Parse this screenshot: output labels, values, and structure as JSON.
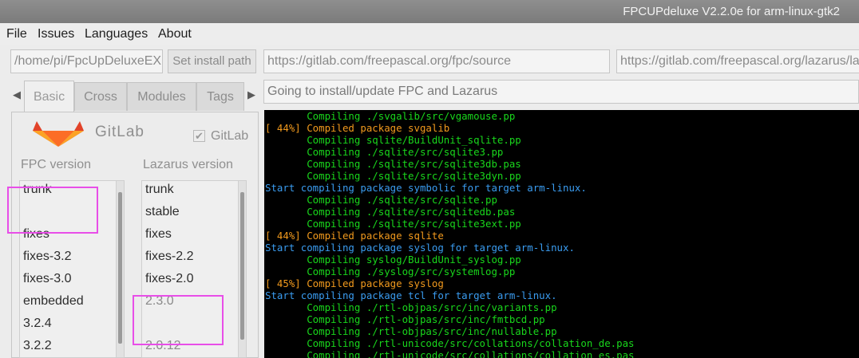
{
  "window": {
    "title": "FPCUPdeluxe V2.2.0e for arm-linux-gtk2"
  },
  "menu": {
    "items": [
      "File",
      "Issues",
      "Languages",
      "About"
    ]
  },
  "install_path": {
    "value": "/home/pi/FpcUpDeluxeEX",
    "button_label": "Set install path"
  },
  "urls": {
    "fpc_source": "https://gitlab.com/freepascal.org/fpc/source",
    "lazarus_source": "https://gitlab.com/freepascal.org/lazarus/la"
  },
  "status": {
    "text": "Going to install/update FPC and Lazarus"
  },
  "tabs": [
    "Basic",
    "Cross",
    "Modules",
    "Tags"
  ],
  "gitlab": {
    "logo_text": "GitLab",
    "checkbox_label": "GitLab",
    "checked": true
  },
  "fpc": {
    "label": "FPC version",
    "items": [
      "trunk",
      "",
      "fixes",
      "fixes-3.2",
      "fixes-3.0",
      "embedded",
      "3.2.4",
      "3.2.2"
    ]
  },
  "lazarus": {
    "label": "Lazarus version",
    "items": [
      "trunk",
      "stable",
      "fixes",
      "fixes-2.2",
      "fixes-2.0",
      "2.3.0",
      "",
      "2.0.12"
    ]
  },
  "colors": {
    "green": "#19d71c",
    "orange": "#f29a1d",
    "blue": "#3a9cf0",
    "highlight": "#e84ee8"
  },
  "console": {
    "lines": [
      {
        "text": "       Compiling ./svgalib/src/vgamouse.pp",
        "color": "green"
      },
      {
        "text": "[ 44%] Compiled package svgalib",
        "color": "orange"
      },
      {
        "text": "       Compiling sqlite/BuildUnit_sqlite.pp",
        "color": "green"
      },
      {
        "text": "       Compiling ./sqlite/src/sqlite3.pp",
        "color": "green"
      },
      {
        "text": "       Compiling ./sqlite/src/sqlite3db.pas",
        "color": "green"
      },
      {
        "text": "       Compiling ./sqlite/src/sqlite3dyn.pp",
        "color": "green"
      },
      {
        "text": "Start compiling package symbolic for target arm-linux.",
        "color": "blue"
      },
      {
        "text": "       Compiling ./sqlite/src/sqlite.pp",
        "color": "green"
      },
      {
        "text": "       Compiling ./sqlite/src/sqlitedb.pas",
        "color": "green"
      },
      {
        "text": "       Compiling ./sqlite/src/sqlite3ext.pp",
        "color": "green"
      },
      {
        "text": "[ 44%] Compiled package sqlite",
        "color": "orange"
      },
      {
        "text": "Start compiling package syslog for target arm-linux.",
        "color": "blue"
      },
      {
        "text": "       Compiling syslog/BuildUnit_syslog.pp",
        "color": "green"
      },
      {
        "text": "       Compiling ./syslog/src/systemlog.pp",
        "color": "green"
      },
      {
        "text": "[ 45%] Compiled package syslog",
        "color": "orange"
      },
      {
        "text": "Start compiling package tcl for target arm-linux.",
        "color": "blue"
      },
      {
        "text": "       Compiling ./rtl-objpas/src/inc/variants.pp",
        "color": "green"
      },
      {
        "text": "       Compiling ./rtl-objpas/src/inc/fmtbcd.pp",
        "color": "green"
      },
      {
        "text": "       Compiling ./rtl-objpas/src/inc/nullable.pp",
        "color": "green"
      },
      {
        "text": "       Compiling ./rtl-unicode/src/collations/collation_de.pas",
        "color": "green"
      },
      {
        "text": "       Compiling ./rtl-unicode/src/collations/collation_es.pas",
        "color": "green"
      }
    ]
  }
}
